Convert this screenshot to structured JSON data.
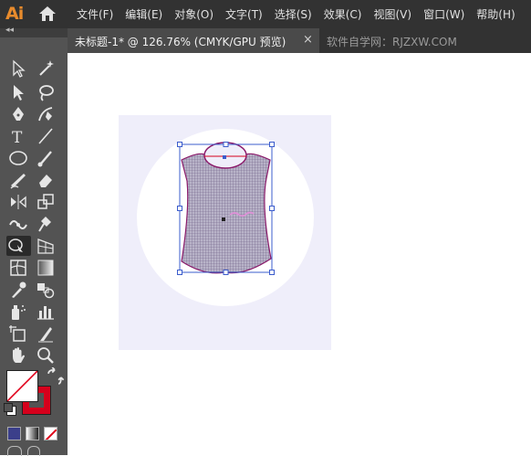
{
  "app": {
    "logo": "Ai"
  },
  "menu": [
    "文件(F)",
    "编辑(E)",
    "对象(O)",
    "文字(T)",
    "选择(S)",
    "效果(C)",
    "视图(V)",
    "窗口(W)",
    "帮助(H)"
  ],
  "tabs": {
    "active": "未标题-1* @ 126.76% (CMYK/GPU 预览)",
    "close": "×",
    "inactive": "软件自学网：RJZXW.COM"
  },
  "toolbar": {
    "collapse": "◂◂"
  },
  "colors": {
    "fill": "#ffffff",
    "stroke": "#d6001c",
    "artboard": "#efeefa",
    "shape": "#b8b3c8",
    "outline": "#8a1a6a",
    "selection": "#3b5ccc"
  }
}
